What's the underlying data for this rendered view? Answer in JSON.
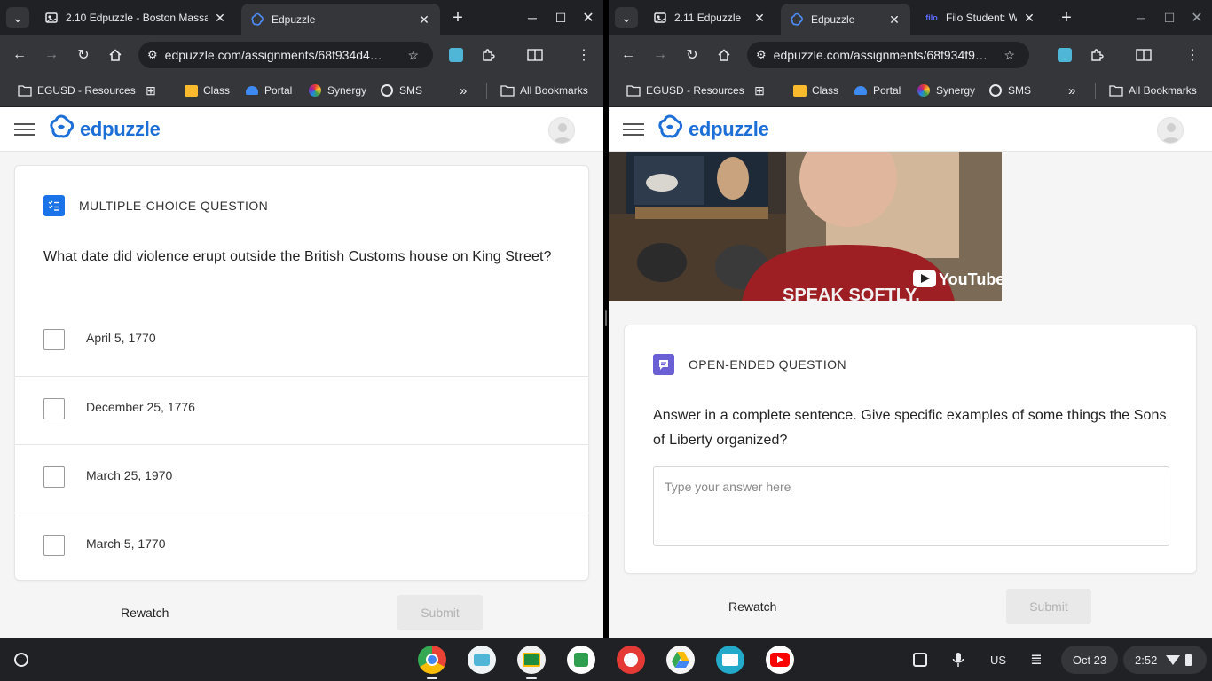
{
  "left": {
    "tabs": [
      {
        "title": "2.10 Edpuzzle - Boston Massa",
        "active": false
      },
      {
        "title": "Edpuzzle",
        "active": true
      }
    ],
    "url": "edpuzzle.com/assignments/68f934d4…",
    "bookmarks": [
      "EGUSD - Resources",
      "Class",
      "Portal",
      "Synergy",
      "SMS",
      "All Bookmarks"
    ],
    "brand": "edpuzzle",
    "question_type": "MULTIPLE-CHOICE QUESTION",
    "question": "What date did violence erupt outside the British Customs house on King Street?",
    "choices": [
      "April 5, 1770",
      "December 25, 1776",
      "March 25, 1970",
      "March 5, 1770"
    ],
    "rewatch_label": "Rewatch",
    "submit_label": "Submit"
  },
  "right": {
    "tabs": [
      {
        "title": "2.11 Edpuzzle",
        "active": false
      },
      {
        "title": "Edpuzzle",
        "active": true
      },
      {
        "title": "Filo Student: W",
        "active": false
      }
    ],
    "url": "edpuzzle.com/assignments/68f934f9…",
    "bookmarks": [
      "EGUSD - Resources",
      "Class",
      "Portal",
      "Synergy",
      "SMS",
      "All Bookmarks"
    ],
    "brand": "edpuzzle",
    "video_text": "SPEAK SOFTLY,",
    "youtube_label": "YouTube",
    "question_type": "OPEN-ENDED QUESTION",
    "question": "Answer in a complete sentence. Give specific examples of some things the Sons of Liberty organized?",
    "answer_placeholder": "Type your answer here",
    "rewatch_label": "Rewatch",
    "submit_label": "Submit"
  },
  "shelf": {
    "apps": [
      "chrome-icon",
      "cloud-app-icon",
      "google-classroom-icon",
      "green-app-icon",
      "palette-app-icon",
      "google-drive-icon",
      "reader-app-icon",
      "youtube-icon"
    ],
    "ime": "US",
    "date": "Oct 23",
    "time": "2:52"
  },
  "colors": {
    "brand_blue": "#1d6fd8",
    "mc_badge": "#1a73e8",
    "open_badge": "#6b5fd6",
    "chrome_dark": "#202124",
    "chrome_toolbar": "#35363a"
  }
}
